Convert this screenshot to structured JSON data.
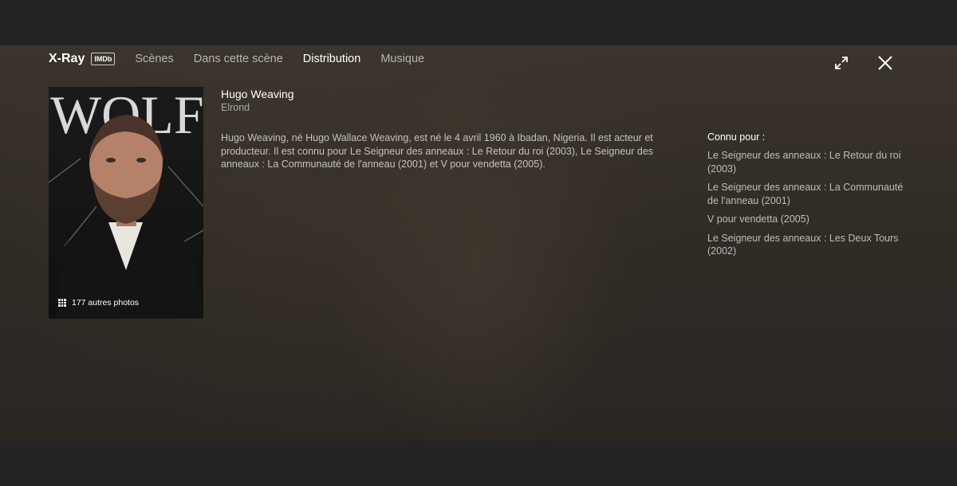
{
  "header": {
    "brand": "X-Ray",
    "badge": "IMDb",
    "tabs": [
      {
        "label": "Scènes",
        "active": false
      },
      {
        "label": "Dans cette scène",
        "active": false
      },
      {
        "label": "Distribution",
        "active": true
      },
      {
        "label": "Musique",
        "active": false
      }
    ],
    "icons": {
      "expand": "expand-icon",
      "close": "close-icon"
    }
  },
  "actor": {
    "name": "Hugo Weaving",
    "role": "Elrond",
    "photo_backdrop_text": "WOLF",
    "photos_label": "177 autres photos",
    "bio": "Hugo Weaving, né Hugo Wallace Weaving, est né le 4 avril 1960 à Ibadan, Nigeria. Il est acteur et producteur. Il est connu pour Le Seigneur des anneaux : Le Retour du roi (2003), Le Seigneur des anneaux : La Communauté de l'anneau (2001) et V pour vendetta (2005)."
  },
  "known_for": {
    "heading": "Connu pour :",
    "items": [
      "Le Seigneur des anneaux : Le Retour du roi (2003)",
      "Le Seigneur des anneaux : La Communauté de l'anneau (2001)",
      "V pour vendetta (2005)",
      "Le Seigneur des anneaux : Les Deux Tours (2002)"
    ]
  },
  "colors": {
    "background": "#232323",
    "text_primary": "#ffffff",
    "text_secondary": "#b5b5b5"
  }
}
